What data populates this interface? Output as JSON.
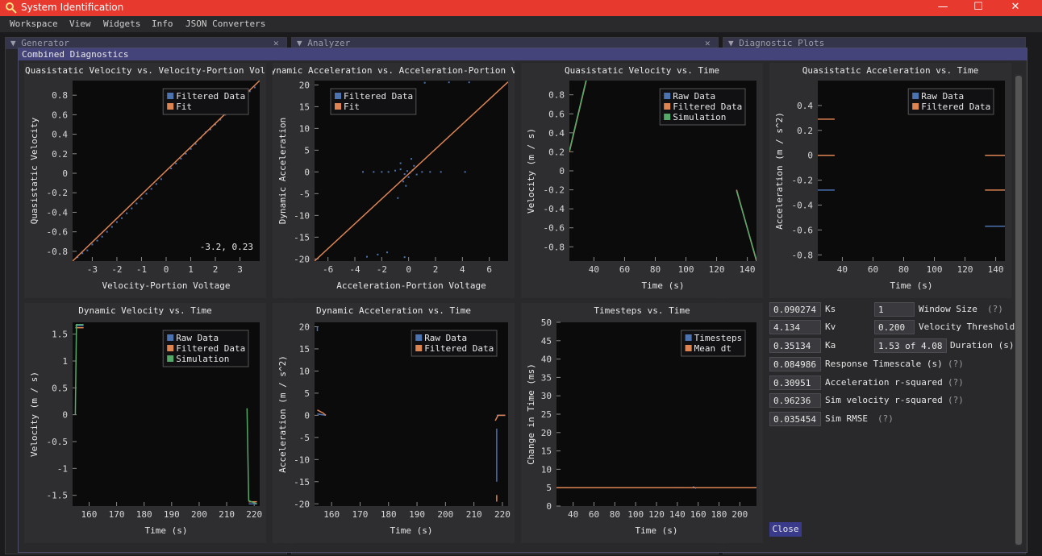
{
  "window": {
    "title": "System Identification"
  },
  "window_controls": {
    "minimize": "—",
    "maximize": "☐",
    "close": "✕"
  },
  "menu": {
    "items": [
      "Workspace",
      "View",
      "Widgets",
      "Info",
      "JSON Converters"
    ]
  },
  "background_panels": {
    "generator": {
      "title": "▼ Generator",
      "close": "✕"
    },
    "analyzer": {
      "title": "▼ Analyzer",
      "close": "✕"
    },
    "diagnostic_plots": {
      "title": "▼ Diagnostic Plots"
    }
  },
  "modal": {
    "title": "Combined Diagnostics"
  },
  "colors": {
    "blue": "#4c72b0",
    "orange": "#dd8452",
    "green": "#55a868",
    "plot_bg": "#0b0b0c",
    "frame_bg": "#2e2e30"
  },
  "chart_data": [
    {
      "type": "scatter",
      "title": "Quasistatic Velocity vs. Velocity-Portion Vol",
      "xlabel": "Velocity-Portion Voltage",
      "ylabel": "Quasistatic Velocity",
      "xlim": [
        -3.8,
        3.8
      ],
      "ylim": [
        -0.9,
        0.95
      ],
      "xticks": [
        -3,
        -2,
        -1,
        0,
        1,
        2,
        3
      ],
      "yticks": [
        -0.8,
        -0.6,
        -0.4,
        -0.2,
        0,
        0.2,
        0.4,
        0.6,
        0.8
      ],
      "legend": [
        "Filtered Data",
        "Fit"
      ],
      "annotation": "-3.2, 0.23",
      "series": [
        {
          "name": "Filtered Data",
          "color": "blue",
          "kind": "points",
          "points": [
            [
              -3.6,
              -0.86
            ],
            [
              -3.4,
              -0.82
            ],
            [
              -3.2,
              -0.79
            ],
            [
              -3.0,
              -0.73
            ],
            [
              -2.8,
              -0.69
            ],
            [
              -2.6,
              -0.65
            ],
            [
              -2.4,
              -0.6
            ],
            [
              -2.2,
              -0.55
            ],
            [
              -2.0,
              -0.5
            ],
            [
              -1.8,
              -0.46
            ],
            [
              -1.6,
              -0.41
            ],
            [
              -1.4,
              -0.36
            ],
            [
              -1.2,
              -0.31
            ],
            [
              -1.0,
              -0.26
            ],
            [
              -0.8,
              -0.21
            ],
            [
              -0.6,
              -0.16
            ],
            [
              -0.4,
              -0.11
            ],
            [
              -0.2,
              -0.06
            ],
            [
              0.2,
              0.05
            ],
            [
              0.4,
              0.1
            ],
            [
              0.6,
              0.15
            ],
            [
              0.8,
              0.2
            ],
            [
              1.0,
              0.25
            ],
            [
              1.2,
              0.3
            ],
            [
              1.4,
              0.36
            ],
            [
              1.6,
              0.42
            ],
            [
              1.8,
              0.45
            ],
            [
              2.0,
              0.5
            ],
            [
              2.2,
              0.55
            ],
            [
              2.4,
              0.6
            ],
            [
              2.6,
              0.66
            ],
            [
              2.8,
              0.7
            ],
            [
              3.0,
              0.75
            ],
            [
              3.2,
              0.79
            ],
            [
              3.4,
              0.84
            ],
            [
              3.6,
              0.88
            ]
          ]
        },
        {
          "name": "Fit",
          "color": "orange",
          "kind": "line",
          "points": [
            [
              -3.8,
              -0.9
            ],
            [
              3.8,
              0.95
            ]
          ]
        }
      ]
    },
    {
      "type": "scatter",
      "title": "Dynamic Acceleration vs. Acceleration-Portion Vo",
      "xlabel": "Acceleration-Portion Voltage",
      "ylabel": "Dynamic Acceleration",
      "xlim": [
        -7,
        7.4
      ],
      "ylim": [
        -20.5,
        21
      ],
      "xticks": [
        -6,
        -4,
        -2,
        0,
        2,
        4,
        6
      ],
      "yticks": [
        -20,
        -15,
        -10,
        -5,
        0,
        5,
        10,
        15,
        20
      ],
      "legend": [
        "Filtered Data",
        "Fit"
      ],
      "series": [
        {
          "name": "Filtered Data",
          "color": "blue",
          "kind": "points",
          "points": [
            [
              -3.4,
              0
            ],
            [
              -2.6,
              0
            ],
            [
              -2.0,
              0
            ],
            [
              -1.5,
              0
            ],
            [
              -1.0,
              0.3
            ],
            [
              -0.6,
              0.6
            ],
            [
              -0.3,
              -0.5
            ],
            [
              -0.1,
              0.2
            ],
            [
              0.1,
              -0.2
            ],
            [
              0.3,
              0.4
            ],
            [
              0.6,
              -0.6
            ],
            [
              1.0,
              0
            ],
            [
              1.6,
              0
            ],
            [
              2.4,
              0
            ],
            [
              4.2,
              0
            ],
            [
              -0.6,
              2
            ],
            [
              0.2,
              3
            ],
            [
              -0.4,
              -2.2
            ],
            [
              -0.8,
              -6
            ],
            [
              -1.6,
              -18.5
            ],
            [
              -2.3,
              -19
            ],
            [
              -3.1,
              -19.5
            ],
            [
              -0.3,
              -19.6
            ],
            [
              1.2,
              20.5
            ],
            [
              3.0,
              20.6
            ],
            [
              4.5,
              20.6
            ],
            [
              0.0,
              -1.2
            ],
            [
              0.4,
              1.4
            ],
            [
              -0.2,
              -3.2
            ]
          ]
        },
        {
          "name": "Fit",
          "color": "orange",
          "kind": "line",
          "points": [
            [
              -7,
              -20.5
            ],
            [
              7.4,
              20.7
            ]
          ]
        }
      ]
    },
    {
      "type": "line",
      "title": "Quasistatic Velocity vs. Time",
      "xlabel": "Time (s)",
      "ylabel": "Velocity (m / s)",
      "xlim": [
        24,
        146
      ],
      "ylim": [
        -0.95,
        0.95
      ],
      "xticks": [
        40,
        60,
        80,
        100,
        120,
        140
      ],
      "yticks": [
        -0.8,
        -0.6,
        -0.4,
        -0.2,
        0,
        0.2,
        0.4,
        0.6,
        0.8
      ],
      "legend": [
        "Raw Data",
        "Filtered Data",
        "Simulation"
      ],
      "series": [
        {
          "name": "Raw Data",
          "color": "blue",
          "kind": "line",
          "segments": [
            [
              [
                24,
                0.2
              ],
              [
                35,
                0.95
              ]
            ],
            [
              [
                133,
                -0.2
              ],
              [
                146,
                -0.95
              ]
            ]
          ]
        },
        {
          "name": "Filtered Data",
          "color": "orange",
          "kind": "line",
          "segments": [
            [
              [
                24,
                0.2
              ],
              [
                35,
                0.95
              ]
            ],
            [
              [
                133,
                -0.2
              ],
              [
                146,
                -0.95
              ]
            ]
          ]
        },
        {
          "name": "Simulation",
          "color": "green",
          "kind": "line",
          "segments": [
            [
              [
                24,
                0.21
              ],
              [
                35,
                0.96
              ]
            ],
            [
              [
                133,
                -0.21
              ],
              [
                146,
                -0.94
              ]
            ]
          ]
        }
      ]
    },
    {
      "type": "line",
      "title": "Quasistatic Acceleration vs. Time",
      "xlabel": "Time (s)",
      "ylabel": "Acceleration (m / s^2)",
      "xlim": [
        24,
        146
      ],
      "ylim": [
        -0.85,
        0.6
      ],
      "xticks": [
        40,
        60,
        80,
        100,
        120,
        140
      ],
      "yticks": [
        -0.8,
        -0.6,
        -0.4,
        -0.2,
        0,
        0.2,
        0.4
      ],
      "legend": [
        "Raw Data",
        "Filtered Data"
      ],
      "series": [
        {
          "name": "Raw Data",
          "color": "blue",
          "kind": "line",
          "segments": [
            [
              [
                24,
                -0.28
              ],
              [
                35,
                -0.28
              ]
            ],
            [
              [
                133,
                -0.57
              ],
              [
                146,
                -0.57
              ]
            ],
            [
              [
                146,
                0.29
              ],
              [
                146,
                0.29
              ]
            ]
          ]
        },
        {
          "name": "Filtered Data",
          "color": "orange",
          "kind": "line",
          "segments": [
            [
              [
                24,
                0.29
              ],
              [
                35,
                0.29
              ]
            ],
            [
              [
                24,
                0
              ],
              [
                35,
                0
              ]
            ],
            [
              [
                133,
                0
              ],
              [
                146,
                0
              ]
            ],
            [
              [
                133,
                -0.28
              ],
              [
                146,
                -0.28
              ]
            ]
          ]
        }
      ]
    },
    {
      "type": "line",
      "title": "Dynamic Velocity vs. Time",
      "xlabel": "Time (s)",
      "ylabel": "Velocity (m / s)",
      "xlim": [
        154,
        222
      ],
      "ylim": [
        -1.7,
        1.72
      ],
      "xticks": [
        160,
        170,
        180,
        190,
        200,
        210,
        220
      ],
      "yticks": [
        -1.5,
        -1,
        -0.5,
        0,
        0.5,
        1,
        1.5
      ],
      "legend": [
        "Raw Data",
        "Filtered Data",
        "Simulation"
      ],
      "series": [
        {
          "name": "Raw Data",
          "color": "blue",
          "kind": "line",
          "segments": [
            [
              [
                155,
                1.66
              ],
              [
                158,
                1.66
              ]
            ],
            [
              [
                218,
                -1.66
              ],
              [
                221,
                -1.66
              ]
            ]
          ]
        },
        {
          "name": "Filtered Data",
          "color": "orange",
          "kind": "line",
          "segments": [
            [
              [
                155,
                1.62
              ],
              [
                158,
                1.62
              ]
            ],
            [
              [
                218,
                -1.62
              ],
              [
                221,
                -1.62
              ]
            ]
          ]
        },
        {
          "name": "Simulation",
          "color": "green",
          "kind": "line",
          "segments": [
            [
              [
                155,
                0
              ],
              [
                155.4,
                1.68
              ],
              [
                158,
                1.68
              ]
            ],
            [
              [
                217.4,
                0.12
              ],
              [
                218,
                -1.6
              ],
              [
                221,
                -1.66
              ]
            ]
          ]
        }
      ]
    },
    {
      "type": "line",
      "title": "Dynamic Acceleration vs. Time",
      "xlabel": "Time (s)",
      "ylabel": "Acceleration (m / s^2)",
      "xlim": [
        154,
        222
      ],
      "ylim": [
        -20.5,
        21
      ],
      "xticks": [
        160,
        170,
        180,
        190,
        200,
        210,
        220
      ],
      "yticks": [
        -20,
        -15,
        -10,
        -5,
        0,
        5,
        10,
        15,
        20
      ],
      "legend": [
        "Raw Data",
        "Filtered Data"
      ],
      "series": [
        {
          "name": "Raw Data",
          "color": "blue",
          "kind": "line",
          "segments": [
            [
              [
                155,
                0.3
              ],
              [
                158,
                0
              ]
            ],
            [
              [
                218,
                0
              ],
              [
                221,
                0
              ]
            ],
            [
              [
                218,
                -3
              ],
              [
                218,
                -15
              ]
            ],
            [
              [
                155,
                19
              ],
              [
                155,
                20
              ]
            ]
          ]
        },
        {
          "name": "Filtered Data",
          "color": "orange",
          "kind": "line",
          "segments": [
            [
              [
                155,
                1.2
              ],
              [
                157,
                0.5
              ],
              [
                158,
                0
              ]
            ],
            [
              [
                217.5,
                -1.2
              ],
              [
                218.5,
                0
              ],
              [
                221,
                0
              ]
            ],
            [
              [
                218,
                -18
              ],
              [
                218,
                -19.5
              ]
            ]
          ]
        }
      ]
    },
    {
      "type": "line",
      "title": "Timesteps vs. Time",
      "xlabel": "Time (s)",
      "ylabel": "Change in Time (ms)",
      "xlim": [
        24,
        216
      ],
      "ylim": [
        0,
        50
      ],
      "xticks": [
        40,
        60,
        80,
        100,
        120,
        140,
        160,
        180,
        200
      ],
      "yticks": [
        0,
        5,
        10,
        15,
        20,
        25,
        30,
        35,
        40,
        45,
        50
      ],
      "legend": [
        "Timesteps",
        "Mean dt"
      ],
      "series": [
        {
          "name": "Timesteps",
          "color": "blue",
          "kind": "line",
          "segments": [
            [
              [
                24,
                5
              ],
              [
                36,
                5
              ]
            ],
            [
              [
                135,
                5
              ],
              [
                147,
                5
              ]
            ],
            [
              [
                155,
                5.3
              ],
              [
                158,
                4.8
              ]
            ],
            [
              [
                213,
                5
              ],
              [
                216,
                5
              ]
            ]
          ]
        },
        {
          "name": "Mean dt",
          "color": "orange",
          "kind": "line",
          "segments": [
            [
              [
                24,
                5
              ],
              [
                216,
                5
              ]
            ]
          ]
        }
      ]
    }
  ],
  "params": {
    "ks": {
      "value": "0.090274",
      "label": "Ks"
    },
    "kv": {
      "value": "4.134",
      "label": "Kv"
    },
    "ka": {
      "value": "0.35134",
      "label": "Ka"
    },
    "window_size": {
      "value": "1",
      "label": "Window Size",
      "help": "(?)"
    },
    "velocity_threshold": {
      "value": "0.200",
      "label": "Velocity Threshold"
    },
    "duration": {
      "value": "1.53 of 4.08",
      "label": "Duration (s)"
    },
    "response_timescale": {
      "value": "0.084986",
      "label": "Response Timescale (s)",
      "help": "(?)"
    },
    "accel_r2": {
      "value": "0.30951",
      "label": "Acceleration r-squared",
      "help": "(?)"
    },
    "sim_vel_r2": {
      "value": "0.96236",
      "label": "Sim velocity r-squared",
      "help": "(?)"
    },
    "sim_rmse": {
      "value": "0.035454",
      "label": "Sim RMSE",
      "help": "(?)"
    }
  },
  "close_label": "Close"
}
